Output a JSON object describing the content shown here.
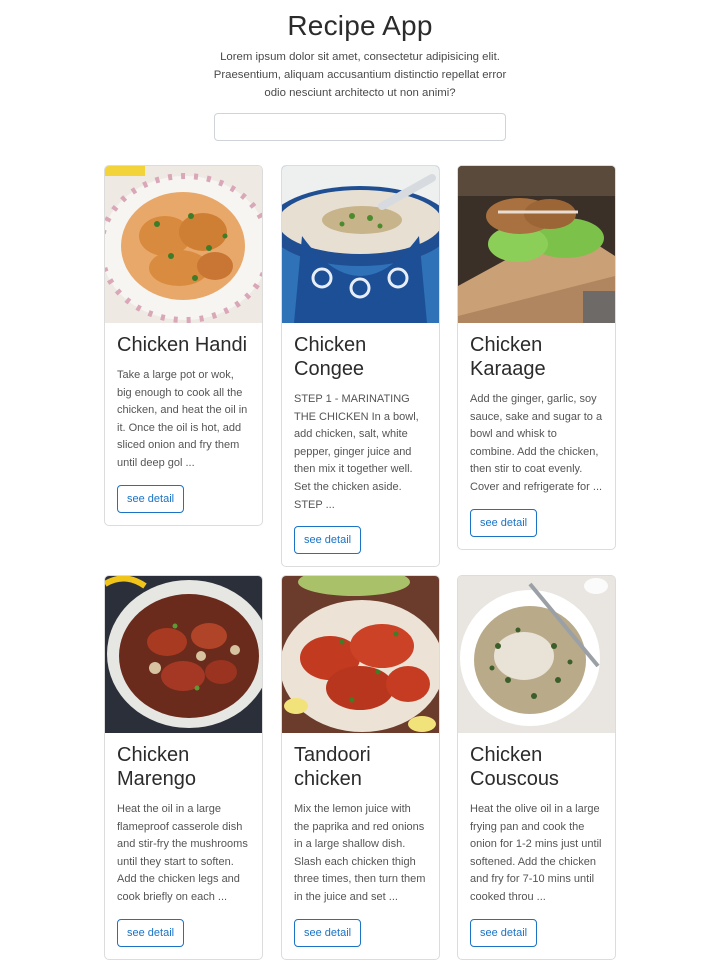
{
  "header": {
    "title": "Recipe App",
    "description": "Lorem ipsum dolor sit amet, consectetur adipisicing elit. Praesentium, aliquam accusantium distinctio repellat error odio nesciunt architecto ut non animi?"
  },
  "search": {
    "value": "",
    "placeholder": ""
  },
  "recipes": [
    {
      "title": "Chicken Handi",
      "excerpt": "Take a large pot or wok, big enough to cook all the chicken, and heat the oil in it. Once the oil is hot, add sliced onion and fry them until deep gol ...",
      "button": "see detail"
    },
    {
      "title": "Chicken Congee",
      "excerpt": "STEP 1 - MARINATING THE CHICKEN In a bowl, add chicken, salt, white pepper, ginger juice and then mix it together well. Set the chicken aside. STEP ...",
      "button": "see detail"
    },
    {
      "title": "Chicken Karaage",
      "excerpt": "Add the ginger, garlic, soy sauce, sake and sugar to a bowl and whisk to combine. Add the chicken, then stir to coat evenly. Cover and refrigerate for ...",
      "button": "see detail"
    },
    {
      "title": "Chicken Marengo",
      "excerpt": "Heat the oil in a large flameproof casserole dish and stir-fry the mushrooms until they start to soften. Add the chicken legs and cook briefly on each ...",
      "button": "see detail"
    },
    {
      "title": "Tandoori chicken",
      "excerpt": "Mix the lemon juice with the paprika and red onions in a large shallow dish. Slash each chicken thigh three times, then turn them in the juice and set ...",
      "button": "see detail"
    },
    {
      "title": "Chicken Couscous",
      "excerpt": "Heat the olive oil in a large frying pan and cook the onion for 1-2 mins just until softened. Add the chicken and fry for 7-10 mins until cooked throu ...",
      "button": "see detail"
    }
  ]
}
